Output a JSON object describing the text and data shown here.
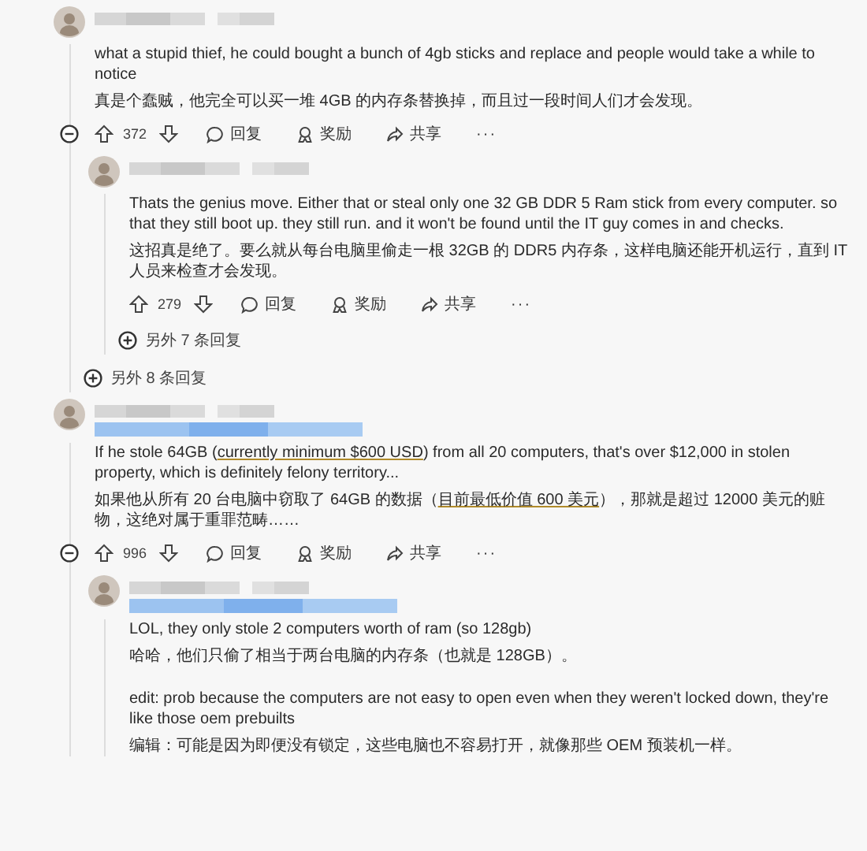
{
  "comments": [
    {
      "collapse": true,
      "paragraphs": [
        {
          "parts": [
            {
              "text": "what a stupid thief, he could bought a bunch of 4gb sticks and replace and people would take a while to notice"
            }
          ]
        },
        {
          "parts": [
            {
              "text": "真是个蠢贼，他完全可以买一堆 4GB 的内存条替换掉，而且过一段时间人们才会发现。"
            }
          ]
        }
      ],
      "votes": "372",
      "reply": "回复",
      "award": "奖励",
      "share": "共享",
      "more": "···",
      "replies": [
        {
          "paragraphs": [
            {
              "parts": [
                {
                  "text": "Thats the genius move. Either that or steal only one 32 GB DDR 5 Ram stick from every computer. so that they still boot up. they still run. and it won't be found until the IT guy comes in and checks."
                }
              ]
            },
            {
              "parts": [
                {
                  "text": "这招真是绝了。要么就从每台电脑里偷走一根 32GB 的 DDR5 内存条，这样电脑还能开机运行，直到 IT 人员来检查才会发现。"
                }
              ]
            }
          ],
          "votes": "279",
          "reply": "回复",
          "award": "奖励",
          "share": "共享",
          "more": "···",
          "more_replies": "另外 7 条回复"
        }
      ],
      "more_replies": "另外 8 条回复"
    },
    {
      "flair": true,
      "collapse": true,
      "paragraphs": [
        {
          "parts": [
            {
              "text": "If he stole 64GB ("
            },
            {
              "text": "currently minimum $600 USD",
              "link": true
            },
            {
              "text": ") from all 20 computers, that's over $12,000 in stolen property, which is definitely felony territory..."
            }
          ]
        },
        {
          "parts": [
            {
              "text": "如果他从所有 20 台电脑中窃取了 64GB 的数据（"
            },
            {
              "text": "目前最低价值 600 美元",
              "link": true
            },
            {
              "text": "），那就是超过 12000 美元的赃物，这绝对属于重罪范畴……"
            }
          ]
        }
      ],
      "votes": "996",
      "reply": "回复",
      "award": "奖励",
      "share": "共享",
      "more": "···",
      "replies": [
        {
          "flair": true,
          "paragraphs": [
            {
              "parts": [
                {
                  "text": "LOL, they only stole 2 computers worth of ram (so 128gb)"
                }
              ]
            },
            {
              "parts": [
                {
                  "text": "哈哈，他们只偷了相当于两台电脑的内存条（也就是 128GB）。"
                }
              ]
            },
            {
              "spaced": true,
              "parts": [
                {
                  "text": "edit: prob because the computers are not easy to open even when they weren't locked down, they're like those oem prebuilts"
                }
              ]
            },
            {
              "parts": [
                {
                  "text": "编辑：可能是因为即便没有锁定，这些电脑也不容易打开，就像那些 OEM 预装机一样。"
                }
              ]
            }
          ]
        }
      ]
    }
  ]
}
